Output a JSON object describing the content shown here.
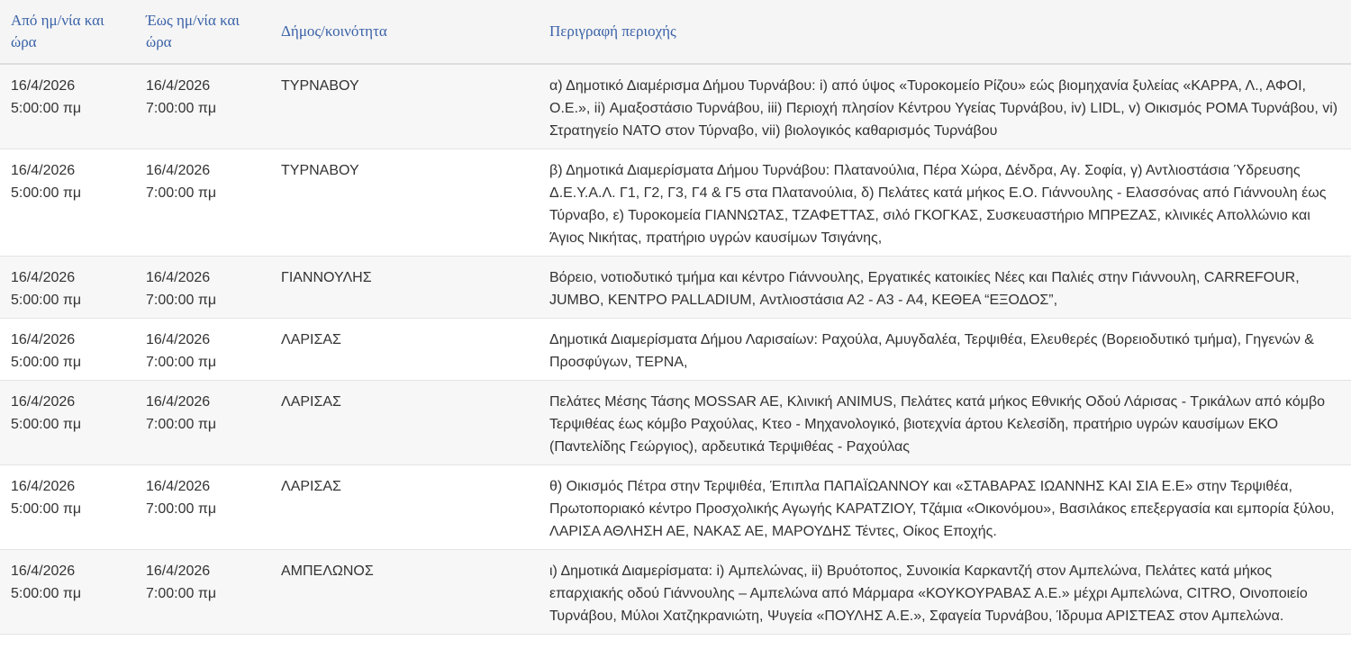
{
  "table": {
    "headers": {
      "from": "Από ημ/νία και ώρα",
      "to": "Έως ημ/νία και ώρα",
      "municipality": "Δήμος/κοινότητα",
      "description": "Περιγραφή περιοχής"
    },
    "rows": [
      {
        "from": "16/4/2026\n5:00:00 πμ",
        "to": "16/4/2026\n7:00:00 πμ",
        "municipality": "ΤΥΡΝΑΒΟΥ",
        "description": "α) Δημοτικό Διαμέρισμα Δήμου Τυρνάβου: i) από ύψος «Τυροκομείο Ρίζου» εώς βιομηχανία ξυλείας «ΚΑΡΡΑ, Λ., ΑΦΟΙ, Ο.Ε.», ii) Αμαξοστάσιο Τυρνάβου, iii) Περιοχή πλησίον Κέντρου Υγείας Τυρνάβου, iv) LIDL, v) Οικισμός ΡΟΜΑ Τυρνάβου, vi) Στρατηγείο ΝΑΤΟ στον Τύρναβο, vii) βιολογικός καθαρισμός Τυρνάβου"
      },
      {
        "from": "16/4/2026\n5:00:00 πμ",
        "to": "16/4/2026\n7:00:00 πμ",
        "municipality": "ΤΥΡΝΑΒΟΥ",
        "description": "β) Δημοτικά Διαμερίσματα Δήμου Τυρνάβου: Πλατανούλια, Πέρα Χώρα, Δένδρα, Αγ. Σοφία, γ) Αντλιοστάσια Ύδρευσης Δ.Ε.Υ.Α.Λ. Γ1, Γ2, Γ3, Γ4 & Γ5 στα Πλατανούλια, δ) Πελάτες κατά μήκος Ε.Ο. Γιάννουλης - Ελασσόνας από Γιάννουλη έως Τύρναβο, ε) Τυροκομεία ΓΙΑΝΝΩΤΑΣ, ΤΖΑΦΕΤΤΑΣ, σιλό ΓΚΟΓΚΑΣ, Συσκευαστήριο ΜΠΡΕΖΑΣ, κλινικές Απολλώνιο και Άγιος Νικήτας, πρατήριο υγρών καυσίμων Τσιγάνης,"
      },
      {
        "from": "16/4/2026\n5:00:00 πμ",
        "to": "16/4/2026\n7:00:00 πμ",
        "municipality": "ΓΙΑΝΝΟΥΛΗΣ",
        "description": "Βόρειο, νοτιοδυτικό τμήμα και κέντρο Γιάννουλης, Εργατικές κατοικίες Νέες και Παλιές στην Γιάννουλη, CARREFOUR, JUMBO, ΚΕΝΤΡΟ PALLADIUM, Αντλιοστάσια Α2 - Α3 - Α4, ΚΕΘΕΑ “ΕΞΟΔΟΣ”,"
      },
      {
        "from": "16/4/2026\n5:00:00 πμ",
        "to": "16/4/2026\n7:00:00 πμ",
        "municipality": "ΛΑΡΙΣΑΣ",
        "description": "Δημοτικά Διαμερίσματα Δήμου Λαρισαίων: Ραχούλα, Αμυγδαλέα, Τερψιθέα, Ελευθερές (Βορειοδυτικό τμήμα), Γηγενών & Προσφύγων, ΤΕΡΝΑ,"
      },
      {
        "from": "16/4/2026\n5:00:00 πμ",
        "to": "16/4/2026\n7:00:00 πμ",
        "municipality": "ΛΑΡΙΣΑΣ",
        "description": "Πελάτες Μέσης Τάσης MOSSAR AE, Κλινική ANIMUS, Πελάτες κατά μήκος Εθνικής Οδού Λάρισας - Τρικάλων από κόμβο Τερψιθέας έως κόμβο Ραχούλας, Κτεο - Μηχανολογικό, βιοτεχνία άρτου Κελεσίδη, πρατήριο υγρών καυσίμων ΕΚΟ (Παντελίδης Γεώργιος), αρδευτικά Τερψιθέας - Ραχούλας"
      },
      {
        "from": "16/4/2026\n5:00:00 πμ",
        "to": "16/4/2026\n7:00:00 πμ",
        "municipality": "ΛΑΡΙΣΑΣ",
        "description": "θ) Οικισμός Πέτρα στην Τερψιθέα, Έπιπλα ΠΑΠΑΪΩΑΝΝΟΥ και «ΣΤΑΒΑΡΑΣ ΙΩΑΝΝΗΣ ΚΑΙ ΣΙΑ Ε.Ε» στην Τερψιθέα, Πρωτοποριακό κέντρο Προσχολικής Αγωγής ΚΑΡΑΤΖΙΟΥ, Τζάμια «Οικονόμου», Βασιλάκος επεξεργασία και εμπορία ξύλου, ΛΑΡΙΣΑ ΑΘΛΗΣΗ ΑΕ, ΝΑΚΑΣ ΑΕ, ΜΑΡΟΥΔΗΣ Τέντες, Οίκος Εποχής."
      },
      {
        "from": "16/4/2026\n5:00:00 πμ",
        "to": "16/4/2026\n7:00:00 πμ",
        "municipality": "ΑΜΠΕΛΩΝΟΣ",
        "description": "ι) Δημοτικά Διαμερίσματα: i) Αμπελώνας, ii) Βρυότοπος, Συνοικία Καρκαντζή στον Αμπελώνα, Πελάτες κατά μήκος επαρχιακής οδού Γιάννουλης – Αμπελώνα από Μάρμαρα «ΚΟΥΚΟΥΡΑΒΑΣ Α.Ε.» μέχρι Αμπελώνα, CITRO, Οινοποιείο Τυρνάβου, Μύλοι Χατζηκρανιώτη, Ψυγεία «ΠΟΥΛΗΣ Α.Ε.», Σφαγεία Τυρνάβου, Ίδρυμα ΑΡΙΣΤΕΑΣ στον Αμπελώνα."
      }
    ]
  }
}
